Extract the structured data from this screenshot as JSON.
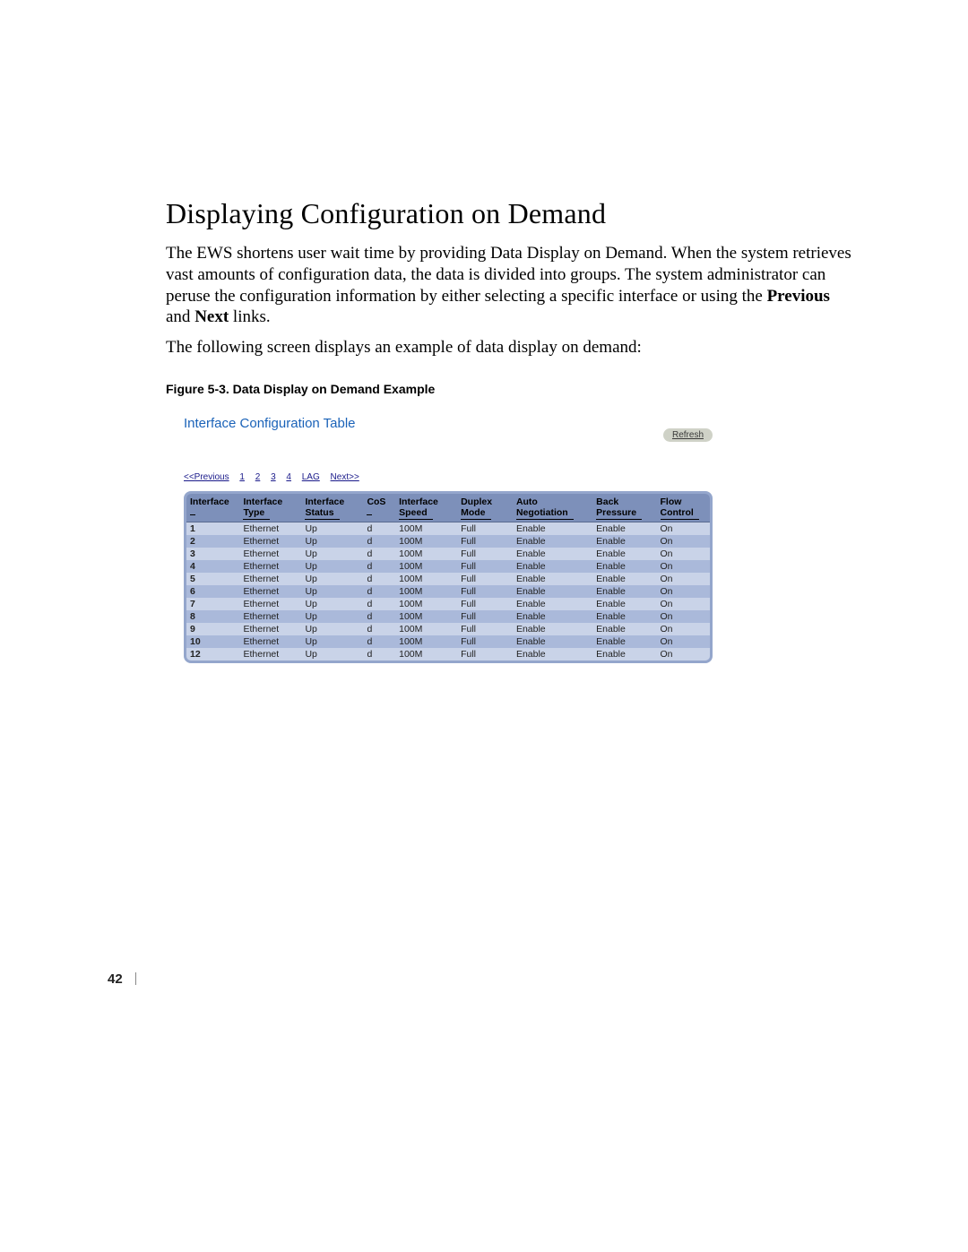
{
  "heading": "Displaying Configuration on Demand",
  "para1_pre": "The EWS shortens user wait time by providing Data Display on Demand. When the system retrieves vast amounts of configuration data, the data is divided into groups. The system administrator can peruse the configuration information by either selecting a specific interface or using the ",
  "para1_bold1": "Previous",
  "para1_mid": " and ",
  "para1_bold2": "Next",
  "para1_post": " links.",
  "para2": "The following screen displays an example of data display on demand:",
  "figcap": "Figure 5-3.    Data Display on Demand Example",
  "screenshot": {
    "title": "Interface Configuration Table",
    "refresh": "Refresh",
    "pager": {
      "prev": "<<Previous",
      "p1": "1",
      "p2": "2",
      "p3": "3",
      "p4": "4",
      "lag": "LAG",
      "next": "Next>>"
    },
    "headers": {
      "iface1": "Interface",
      "iface2": "",
      "type1": "Interface",
      "type2": "Type",
      "status1": "Interface",
      "status2": "Status",
      "cos1": "CoS",
      "cos2": "",
      "speed1": "Interface",
      "speed2": "Speed",
      "duplex1": "Duplex",
      "duplex2": "Mode",
      "auto1": "Auto",
      "auto2": "Negotiation",
      "back1": "Back",
      "back2": "Pressure",
      "flow1": "Flow",
      "flow2": "Control"
    },
    "rows": [
      {
        "iface": "1",
        "type": "Ethernet",
        "status": "Up",
        "cos": "d",
        "speed": "100M",
        "duplex": "Full",
        "auto": "Enable",
        "back": "Enable",
        "flow": "On"
      },
      {
        "iface": "2",
        "type": "Ethernet",
        "status": "Up",
        "cos": "d",
        "speed": "100M",
        "duplex": "Full",
        "auto": "Enable",
        "back": "Enable",
        "flow": "On"
      },
      {
        "iface": "3",
        "type": "Ethernet",
        "status": "Up",
        "cos": "d",
        "speed": "100M",
        "duplex": "Full",
        "auto": "Enable",
        "back": "Enable",
        "flow": "On"
      },
      {
        "iface": "4",
        "type": "Ethernet",
        "status": "Up",
        "cos": "d",
        "speed": "100M",
        "duplex": "Full",
        "auto": "Enable",
        "back": "Enable",
        "flow": "On"
      },
      {
        "iface": "5",
        "type": "Ethernet",
        "status": "Up",
        "cos": "d",
        "speed": "100M",
        "duplex": "Full",
        "auto": "Enable",
        "back": "Enable",
        "flow": "On"
      },
      {
        "iface": "6",
        "type": "Ethernet",
        "status": "Up",
        "cos": "d",
        "speed": "100M",
        "duplex": "Full",
        "auto": "Enable",
        "back": "Enable",
        "flow": "On"
      },
      {
        "iface": "7",
        "type": "Ethernet",
        "status": "Up",
        "cos": "d",
        "speed": "100M",
        "duplex": "Full",
        "auto": "Enable",
        "back": "Enable",
        "flow": "On"
      },
      {
        "iface": "8",
        "type": "Ethernet",
        "status": "Up",
        "cos": "d",
        "speed": "100M",
        "duplex": "Full",
        "auto": "Enable",
        "back": "Enable",
        "flow": "On"
      },
      {
        "iface": "9",
        "type": "Ethernet",
        "status": "Up",
        "cos": "d",
        "speed": "100M",
        "duplex": "Full",
        "auto": "Enable",
        "back": "Enable",
        "flow": "On"
      },
      {
        "iface": "10",
        "type": "Ethernet",
        "status": "Up",
        "cos": "d",
        "speed": "100M",
        "duplex": "Full",
        "auto": "Enable",
        "back": "Enable",
        "flow": "On"
      },
      {
        "iface": "12",
        "type": "Ethernet",
        "status": "Up",
        "cos": "d",
        "speed": "100M",
        "duplex": "Full",
        "auto": "Enable",
        "back": "Enable",
        "flow": "On"
      }
    ]
  },
  "pagenum": "42"
}
